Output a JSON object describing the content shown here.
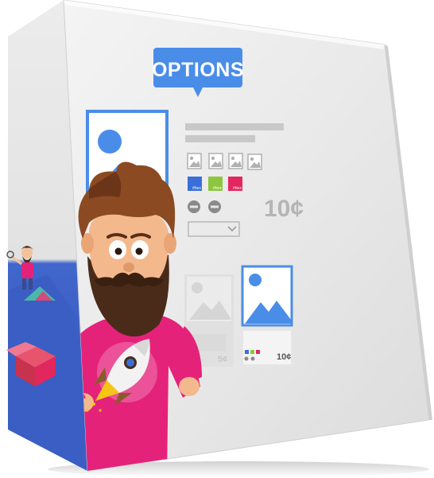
{
  "product": {
    "badge_label": "OPTIONS",
    "price_large": "10¢",
    "card_left_price": "5¢",
    "card_right_price": "10¢",
    "swatch_labels": [
      "#hex",
      "#hex",
      "#hex"
    ]
  },
  "colors": {
    "accent_blue": "#4a8de8",
    "swatch_blue": "#3a6fd8",
    "swatch_green": "#8cc63e",
    "swatch_pink": "#e2265e",
    "box_side_blue": "#3b5fc8",
    "shirt_pink": "#e5227a",
    "beard_brown": "#4a2b1a"
  },
  "icons": [
    "image-placeholder-icon",
    "mountain-icon",
    "sun-icon",
    "minus-circle-icon",
    "dropdown-chevron-icon",
    "rocket-icon",
    "open-box-icon"
  ]
}
